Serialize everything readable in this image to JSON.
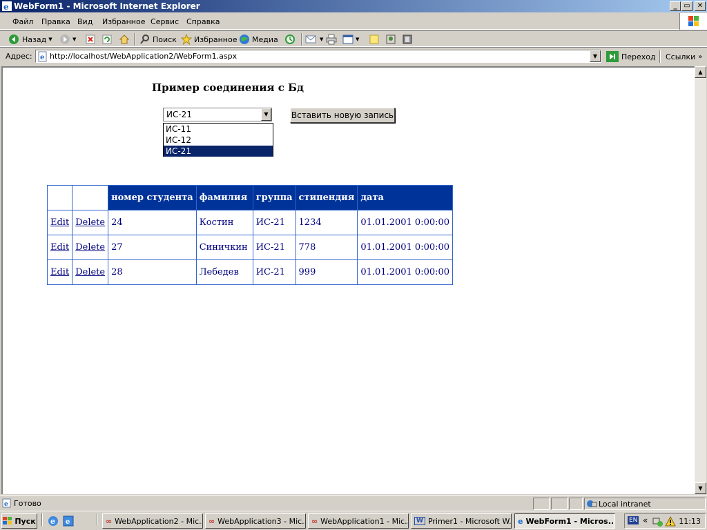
{
  "window": {
    "title": "WebForm1 - Microsoft Internet Explorer",
    "minimize": "_",
    "maximize": "▭",
    "close": "✕"
  },
  "menu": [
    "Файл",
    "Правка",
    "Вид",
    "Избранное",
    "Сервис",
    "Справка"
  ],
  "toolbar": {
    "back_label": "Назад",
    "search_label": "Поиск",
    "favorites_label": "Избранное",
    "media_label": "Медиа"
  },
  "address": {
    "label": "Адрес:",
    "url": "http://localhost/WebApplication2/WebForm1.aspx",
    "go_label": "Переход",
    "links_label": "Ссылки"
  },
  "page": {
    "title": "Пример соединения с Бд",
    "select_value": "ИС-21",
    "options": [
      "ИС-11",
      "ИС-12",
      "ИС-21"
    ],
    "selected_option": "ИС-21",
    "insert_button": "Вставить новую запись",
    "grid": {
      "headers": [
        "",
        "",
        "номер студента",
        "фамилия",
        "группа",
        "стипендия",
        "дата"
      ],
      "edit_label": "Edit",
      "delete_label": "Delete",
      "rows": [
        [
          "24",
          "Костин",
          "ИС-21",
          "1234",
          "01.01.2001 0:00:00"
        ],
        [
          "27",
          "Синичкин",
          "ИС-21",
          "778",
          "01.01.2001 0:00:00"
        ],
        [
          "28",
          "Лебедев",
          "ИС-21",
          "999",
          "01.01.2001 0:00:00"
        ]
      ]
    }
  },
  "status": {
    "text": "Готово",
    "zone": "Local intranet"
  },
  "taskbar": {
    "start": "Пуск",
    "tasks": [
      "WebApplication2 - Mic...",
      "WebApplication3 - Mic...",
      "WebApplication1 - Mic...",
      "Primer1 - Microsoft W...",
      "WebForm1 - Micros..."
    ],
    "lang": "EN",
    "clock": "11:13"
  },
  "colors": {
    "grid_header": "#003399",
    "grid_text": "#000080",
    "selection": "#0a246a",
    "titlebar": "#0a246a"
  }
}
